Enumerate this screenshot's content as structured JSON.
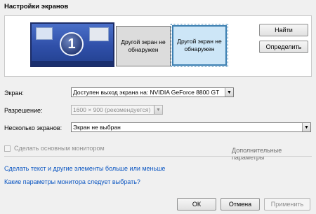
{
  "dialog": {
    "title": "Настройки экранов"
  },
  "monitors": [
    {
      "number": "1"
    },
    {
      "label": "Другой экран не обнаружен"
    },
    {
      "label": "Другой экран не обнаружен"
    }
  ],
  "buttons": {
    "find": "Найти",
    "identify": "Определить",
    "ok": "ОК",
    "cancel": "Отмена",
    "apply": "Применить"
  },
  "fields": {
    "display_label": "Экран:",
    "display_value": "Доступен выход экрана на: NVIDIA GeForce 8800 GT",
    "resolution_label": "Разрешение:",
    "resolution_value": "1600 × 900 (рекомендуется)",
    "multiple_label": "Несколько экранов:",
    "multiple_value": "Экран не выбран"
  },
  "options": {
    "main_monitor": "Сделать основным монитором",
    "advanced": "Дополнительные параметры"
  },
  "links": {
    "text_size": "Сделать текст и другие элементы больше или меньше",
    "which_settings": "Какие параметры монитора следует выбрать?"
  },
  "icons": {
    "dropdown": "chevron-down-icon"
  }
}
